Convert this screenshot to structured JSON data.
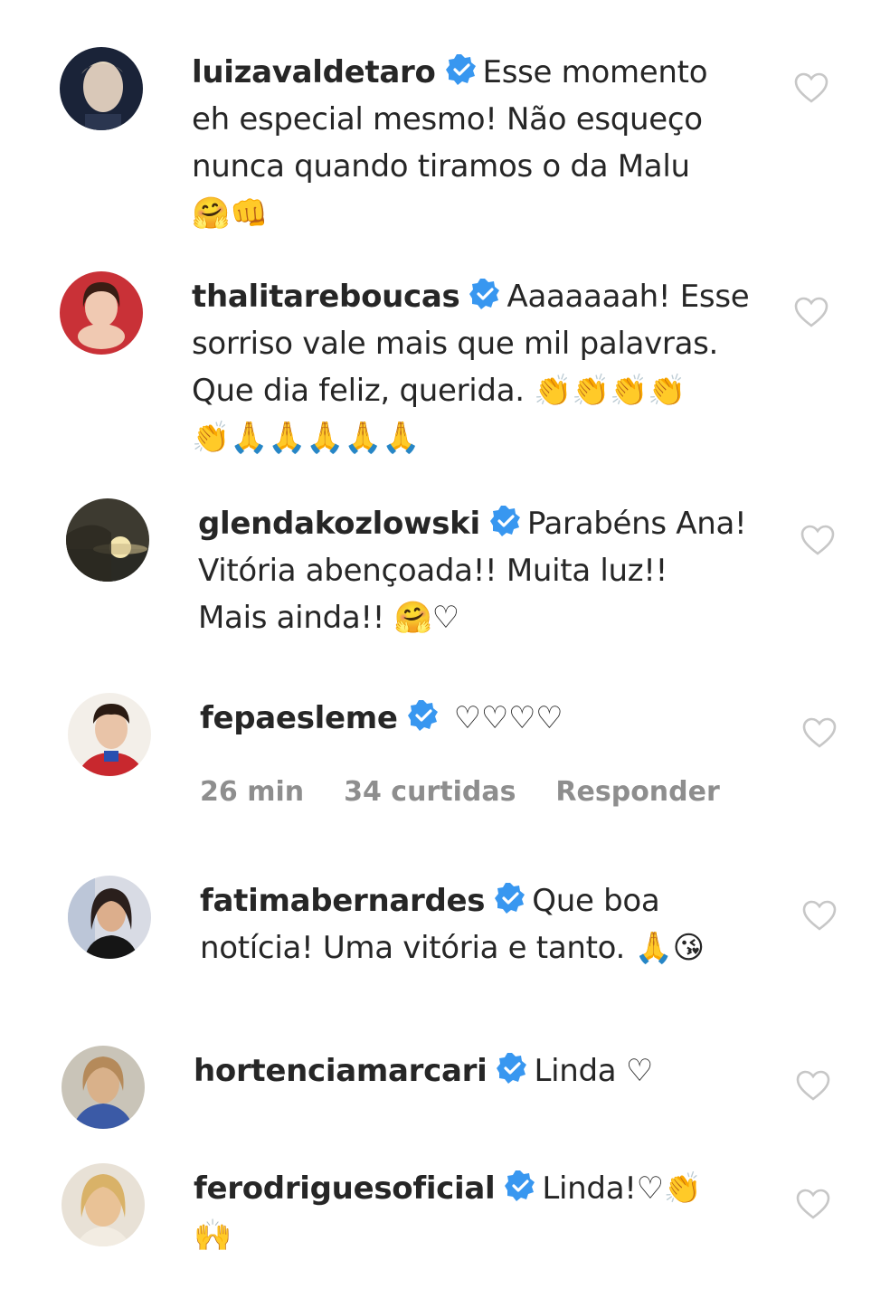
{
  "badge_color": "#3897f0",
  "meta_color": "#8e8e8e",
  "comments": [
    {
      "username": "luizavaldetaro",
      "verified": true,
      "text": "Esse momento eh especial mesmo! Não esqueço nunca quando tiramos o da Malu",
      "line1": "Esse momento",
      "line2": "eh especial mesmo! Não esqueço",
      "line3": "nunca quando tiramos o da Malu",
      "emoji": "🤗👊",
      "avatar_colors": [
        "#1a2338",
        "#d9c8b8"
      ]
    },
    {
      "username": "thalitareboucas",
      "verified": true,
      "text": "Aaaaaaah! Esse sorriso vale mais que mil palavras. Que dia feliz, querida.",
      "line1": "Aaaaaaah! Esse",
      "line2": "sorriso vale mais que mil palavras.",
      "line3": "Que dia feliz, querida.",
      "emoji_inline": "👏👏👏👏",
      "emoji": "👏🙏🙏🙏🙏🙏",
      "avatar_colors": [
        "#c93137",
        "#f0c9b2"
      ]
    },
    {
      "username": "glendakozlowski",
      "verified": true,
      "text": "Parabéns Ana! Vitória abençoada!! Muita luz!! Mais ainda!!",
      "line1": "Parabéns Ana!",
      "line2": "Vitória abençoada!! Muita luz!!",
      "line3": "Mais ainda!!",
      "emoji": "🤗♡",
      "avatar_colors": [
        "#3d3a30",
        "#f4e6b0"
      ]
    },
    {
      "username": "fepaesleme",
      "verified": true,
      "emoji": "♡♡♡♡",
      "time": "26 min",
      "likes": "34 curtidas",
      "reply": "Responder",
      "avatar_colors": [
        "#c8282e",
        "#e9c4a8"
      ]
    },
    {
      "username": "fatimabernardes",
      "verified": true,
      "text": "Que boa notícia! Uma vitória e tanto.",
      "line1": "Que boa",
      "line2": "notícia! Uma vitória e tanto.",
      "emoji": "🙏😘",
      "avatar_colors": [
        "#d8dbe4",
        "#2a1f1c"
      ]
    },
    {
      "username": "hortenciamarcari",
      "verified": true,
      "text": "Linda",
      "emoji": "♡",
      "avatar_colors": [
        "#3b5aa6",
        "#d9b18a"
      ]
    },
    {
      "username": "ferodriguesoficial",
      "verified": true,
      "text": "Linda!",
      "emoji_inline": "♡👏",
      "emoji": "🙌",
      "avatar_colors": [
        "#e8e1d6",
        "#e9c296"
      ]
    }
  ]
}
